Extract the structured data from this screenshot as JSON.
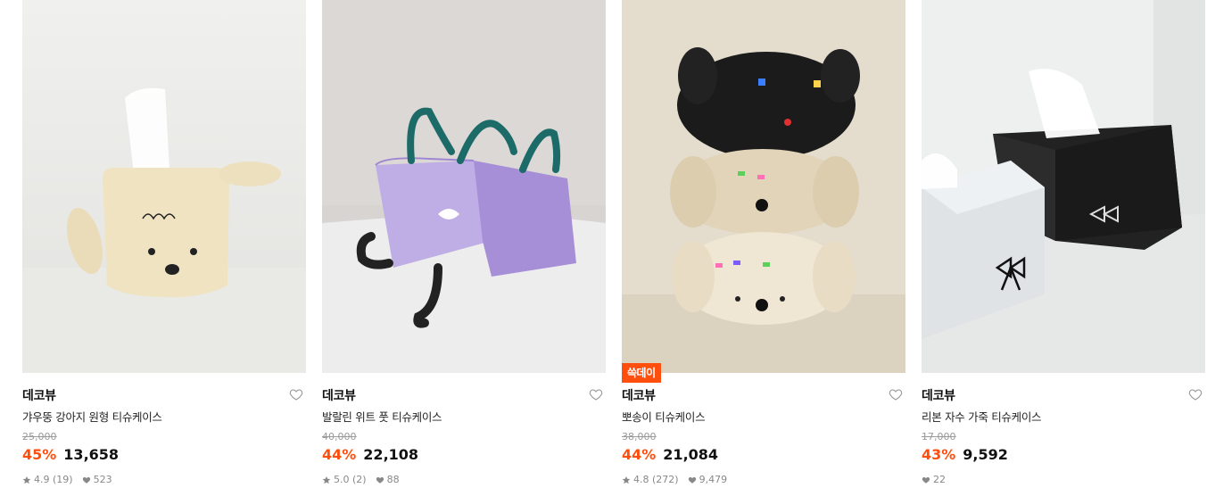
{
  "products": [
    {
      "brand": "데코뷰",
      "name": "갸우뚱 강아지 원형 티슈케이스",
      "original_price": "25,000",
      "discount": "45%",
      "price": "13,658",
      "rating": "4.9",
      "reviews": "(19)",
      "likes": "523",
      "image": "beige-puppy-tissue-case"
    },
    {
      "brand": "데코뷰",
      "name": "발랄린 위트 풋 티슈케이스",
      "original_price": "40,000",
      "discount": "44%",
      "price": "22,108",
      "rating": "5.0",
      "reviews": "(2)",
      "likes": "88",
      "image": "purple-quilted-tissue-case"
    },
    {
      "badge": "쓱데이",
      "brand": "데코뷰",
      "name": "뽀송이 티슈케이스",
      "original_price": "38,000",
      "discount": "44%",
      "price": "21,084",
      "rating": "4.8",
      "reviews": "(272)",
      "likes": "9,479",
      "image": "stacked-poodle-tissue-cases"
    },
    {
      "brand": "데코뷰",
      "name": "리본 자수 가죽 티슈케이스",
      "original_price": "17,000",
      "discount": "43%",
      "price": "9,592",
      "likes": "22",
      "image": "leather-ribbon-tissue-cases"
    }
  ],
  "colors": {
    "accent": "#ff4f0f",
    "strike": "#999999",
    "meta": "#888888"
  },
  "icons": {
    "like": "heart-outline-icon",
    "star": "star-icon",
    "heart": "heart-icon"
  }
}
